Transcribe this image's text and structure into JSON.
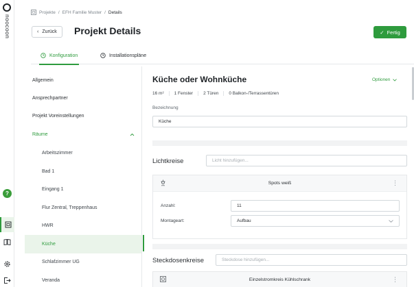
{
  "brand": {
    "name": "noocoon"
  },
  "breadcrumb": {
    "items": [
      "Projekte",
      "EFH Familie Muster"
    ],
    "separator": "/",
    "current": "Details"
  },
  "header": {
    "back_label": "Zurück",
    "title": "Projekt Details",
    "done_label": "Fertig"
  },
  "tabs": [
    {
      "label": "Konfiguration",
      "active": true
    },
    {
      "label": "Installationspläne",
      "active": false
    }
  ],
  "nav": {
    "items": [
      "Allgemein",
      "Ansprechpartner",
      "Projekt Voreinstellungen"
    ],
    "section": "Räume",
    "rooms": [
      "Arbeitszimmer",
      "Bad 1",
      "Eingang 1",
      "Flur Zentral, Treppenhaus",
      "HWR",
      "Küche",
      "Schlafzimmer UG",
      "Veranda"
    ],
    "active_room": "Küche"
  },
  "room": {
    "title": "Küche oder Wohnküche",
    "options_label": "Optionen",
    "stats": {
      "area": "16 m²",
      "windows": "1 Fenster",
      "doors": "2 Türen",
      "balcony": "0 Balkon-/Terrassentüren"
    },
    "name_label": "Bezeichnung",
    "name_value": "Küche"
  },
  "light": {
    "title": "Lichtkreise",
    "add_placeholder": "Licht hinzufügen...",
    "card_title": "Spots weiß",
    "count_label": "Anzahl:",
    "count_value": "11",
    "mount_label": "Montageart:",
    "mount_value": "Aufbau"
  },
  "sockets": {
    "title": "Steckdosenkreise",
    "add_placeholder": "Steckdose hinzufügen...",
    "card_title": "Einzelstromkreis Kühlschrank"
  },
  "colors": {
    "accent": "#2e9b3d",
    "help": "#3a9d3a",
    "active_bg": "#eaf4ea"
  }
}
